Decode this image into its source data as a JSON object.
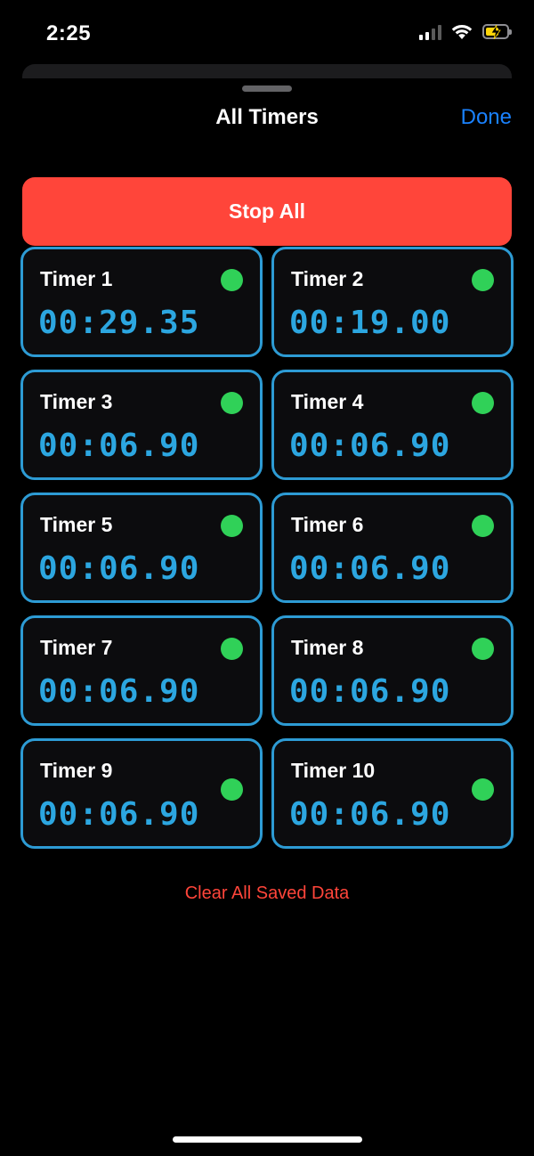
{
  "status_bar": {
    "time": "2:25",
    "icons": [
      "cellular-signal-icon",
      "wifi-icon",
      "battery-charging-icon"
    ]
  },
  "nav": {
    "title": "All Timers",
    "done_label": "Done"
  },
  "stop_all_label": "Stop All",
  "timers": [
    {
      "name": "Timer 1",
      "value": "00:29.35",
      "running": true
    },
    {
      "name": "Timer 2",
      "value": "00:19.00",
      "running": true
    },
    {
      "name": "Timer 3",
      "value": "00:06.90",
      "running": true
    },
    {
      "name": "Timer 4",
      "value": "00:06.90",
      "running": true
    },
    {
      "name": "Timer 5",
      "value": "00:06.90",
      "running": true
    },
    {
      "name": "Timer 6",
      "value": "00:06.90",
      "running": true
    },
    {
      "name": "Timer 7",
      "value": "00:06.90",
      "running": true
    },
    {
      "name": "Timer 8",
      "value": "00:06.90",
      "running": true
    },
    {
      "name": "Timer 9",
      "value": "00:06.90",
      "running": true
    },
    {
      "name": "Timer 10",
      "value": "00:06.90",
      "running": true
    }
  ],
  "clear_data_label": "Clear All Saved Data",
  "colors": {
    "accent_blue": "#1a82ff",
    "timer_border": "#2d9bd4",
    "timer_digits": "#2ca6e0",
    "stop_red": "#ff453a",
    "running_green": "#30d158",
    "battery_yellow": "#ffd60a"
  }
}
